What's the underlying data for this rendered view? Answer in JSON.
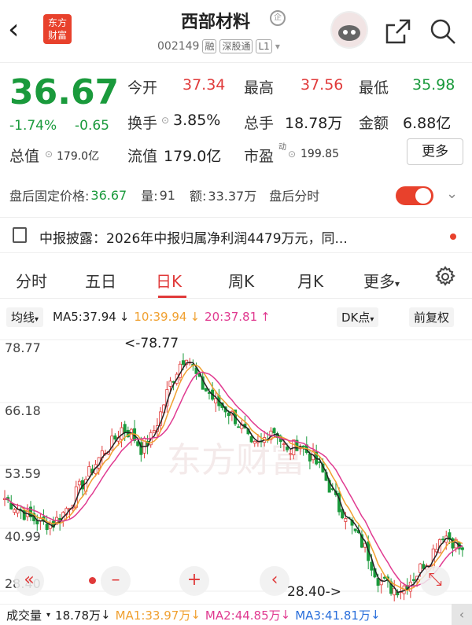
{
  "header": {
    "stock_name": "西部材料",
    "name_badge": "企",
    "code": "002149",
    "tags": [
      "融",
      "深股通",
      "L1"
    ],
    "logo_text": "东方财富"
  },
  "quote": {
    "price": "36.67",
    "change_pct": "-1.74%",
    "change_abs": "-0.65",
    "rows": [
      [
        {
          "label": "今开",
          "value": "37.34",
          "color": "red"
        },
        {
          "label": "最高",
          "value": "37.56",
          "color": "red"
        },
        {
          "label": "最低",
          "value": "35.98",
          "color": "green"
        }
      ],
      [
        {
          "label": "换手",
          "value": "3.85%",
          "color": "black"
        },
        {
          "label": "总手",
          "value": "18.78万",
          "color": "black"
        },
        {
          "label": "金额",
          "value": "6.88亿",
          "color": "black"
        }
      ],
      [
        {
          "label": "总值",
          "value": "179.0亿",
          "color": "black"
        },
        {
          "label": "流值",
          "value": "179.0亿",
          "color": "black"
        },
        {
          "label": "市盈",
          "value": "199.85",
          "color": "black"
        }
      ]
    ],
    "pe_superscript": "动",
    "more_label": "更多"
  },
  "after_hours": {
    "fixed_price_label": "盘后固定价格:",
    "fixed_price": "36.67",
    "volume_label": "量:",
    "volume": "91",
    "amount_label": "额:",
    "amount": "33.37万",
    "timeshare_label": "盘后分时"
  },
  "notice": {
    "text": "中报披露：2026年中报归属净利润4479万元，同..."
  },
  "tabs": [
    "分时",
    "五日",
    "日K",
    "周K",
    "月K",
    "更多"
  ],
  "active_tab": "日K",
  "ma_bar": {
    "mode": "均线",
    "ma5": "MA5:37.94",
    "ma10": "10:39.94",
    "ma20": "20:37.81",
    "dk": "DK点",
    "adjust": "前复权",
    "down_arrow": "↓",
    "up_arrow": "↑"
  },
  "chart_data": {
    "type": "candlestick",
    "y_ticks": [
      "78.77",
      "66.18",
      "53.59",
      "40.99",
      "28.40"
    ],
    "ylim": [
      28.4,
      78.77
    ],
    "high_annotation": "<-78.77",
    "low_annotation": "28.40->",
    "watermark": "东方财富",
    "colors": {
      "up": "#e03a3a",
      "down": "#1a9a3c",
      "ma5": "#222222",
      "ma10": "#f0a030",
      "ma20": "#e03a90"
    }
  },
  "volume_bar": {
    "label": "成交量",
    "value": "18.78万",
    "ma1": "MA1:33.97万",
    "ma2": "MA2:44.85万",
    "ma3": "MA3:41.81万",
    "arrow": "↓"
  },
  "controls": [
    "«",
    "–",
    "+",
    "‹",
    "⤡"
  ]
}
